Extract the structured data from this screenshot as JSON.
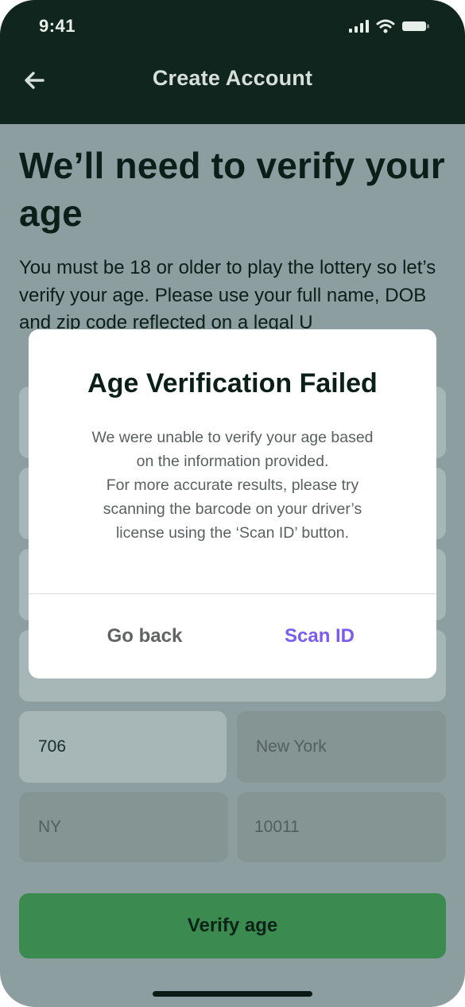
{
  "status_bar": {
    "time": "9:41"
  },
  "header": {
    "title": "Create Account"
  },
  "main": {
    "heading": "We’ll need to verify your age",
    "body": "You must be 18 or older to play the lottery so let’s verify your age. Please use your full name, DOB and zip code reflected on a legal U"
  },
  "form": {
    "house_number": "706",
    "city_placeholder": "New York",
    "state_placeholder": "NY",
    "zip_placeholder": "10011",
    "verify_label": "Verify age"
  },
  "modal": {
    "title": "Age Verification Failed",
    "message_lines": [
      "We were unable to verify your age based",
      "on the information provided.",
      "For more accurate results, please try",
      "scanning the barcode on your driver’s",
      "license using the ‘Scan ID’ button."
    ],
    "go_back_label": "Go back",
    "scan_id_label": "Scan ID"
  },
  "colors": {
    "header_bg": "#0f251d",
    "overlay": "#8d9ea0",
    "primary_button": "#3b8a50",
    "accent": "#7b5cf3"
  },
  "icons": [
    "back-arrow-icon",
    "signal-icon",
    "wifi-icon",
    "battery-icon"
  ]
}
